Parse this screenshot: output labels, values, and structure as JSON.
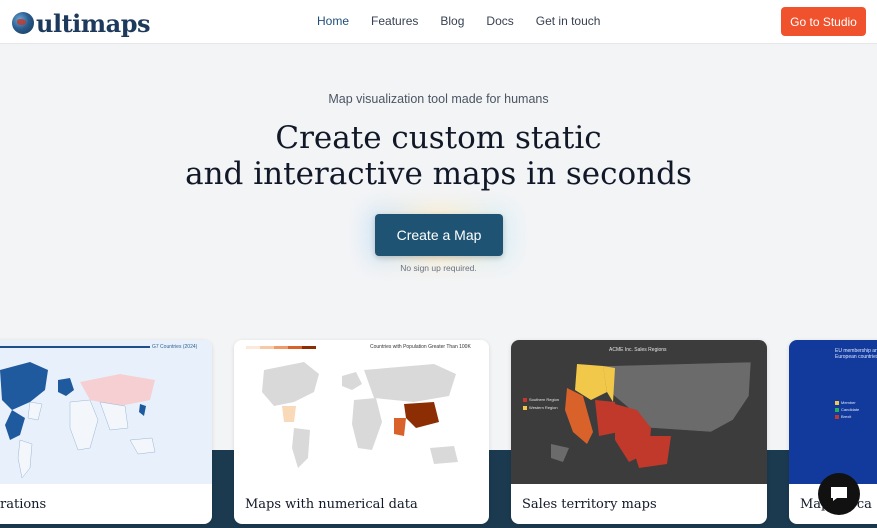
{
  "header": {
    "logo_text": "ultimaps",
    "nav": [
      {
        "label": "Home",
        "active": true
      },
      {
        "label": "Features"
      },
      {
        "label": "Blog"
      },
      {
        "label": "Docs"
      },
      {
        "label": "Get in touch"
      }
    ],
    "studio_label": "Go to Studio"
  },
  "hero": {
    "tagline": "Map visualization tool made for humans",
    "title_line1": "Create custom static",
    "title_line2": "and interactive maps in seconds",
    "cta_label": "Create a Map",
    "note": "No sign up required."
  },
  "showcase": {
    "cards": [
      {
        "label": "rations",
        "map_title": "G7 Countries (2024)"
      },
      {
        "label": "Maps with numerical data",
        "map_title": "Countries with Population Greater Than 100K"
      },
      {
        "label": "Sales territory maps",
        "map_title": "ACME Inc. Sales Regions",
        "legend": [
          "Southern Region",
          "Western Region"
        ]
      },
      {
        "label": "Maps in ca",
        "map_title": "EU membership and European countries",
        "legend": [
          "Member",
          "Candidate",
          "Brexit"
        ]
      }
    ]
  },
  "colors": {
    "accent": "#f0522d",
    "cta": "#1f5373",
    "band": "#1b3a4f",
    "brand": "#1d3a5c"
  },
  "icons": {
    "logo": "globe-icon",
    "chat": "chat-bubble-icon"
  }
}
